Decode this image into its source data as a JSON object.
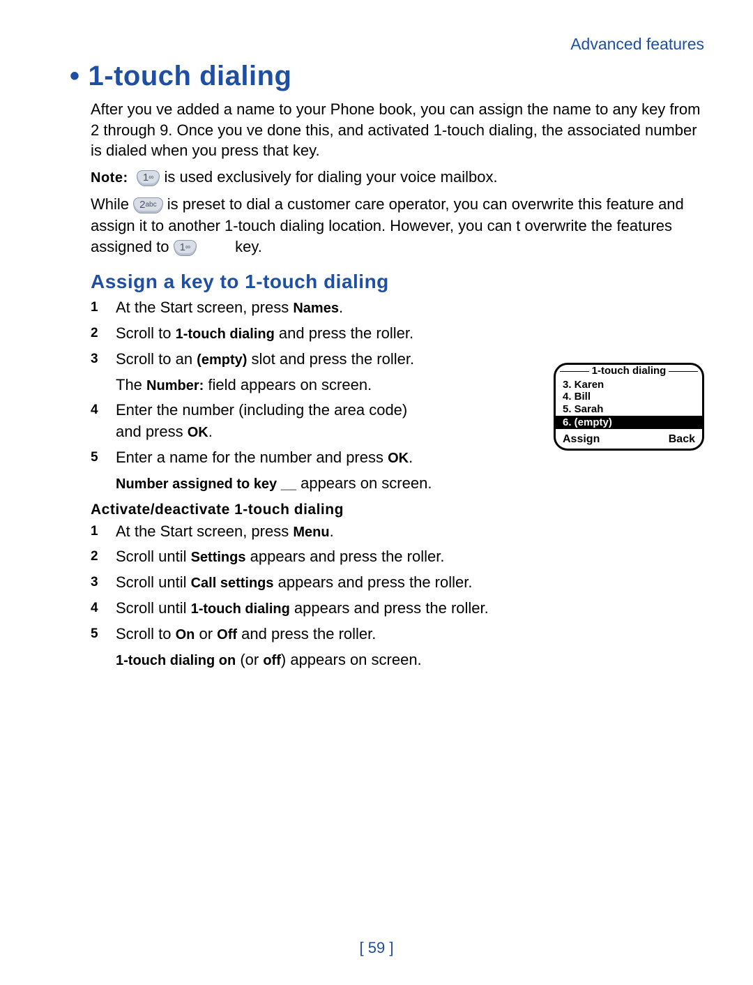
{
  "header": "Advanced features",
  "title": "1-touch dialing",
  "intro": "After you ve added a name to your Phone book, you can assign the name to any key from 2 through 9. Once you ve done this, and activated 1-touch dialing, the associated number is dialed when you press that key.",
  "note": {
    "label": "Note:",
    "key1": "1",
    "key1sym": "∞",
    "after": " is used exclusively for dialing your voice mailbox."
  },
  "while": {
    "pre": "While ",
    "key2": "2",
    "key2abc": "abc",
    "mid": " is preset to dial a customer care operator, you can overwrite this feature and assign it to another 1-touch dialing location. However, you can t overwrite the features assigned to ",
    "key1b": "1",
    "key1bsym": "∞",
    "end": " key."
  },
  "assign_heading": "Assign a key to 1-touch dialing",
  "assign_steps": {
    "s1a": "At the Start screen, press ",
    "s1b": "Names",
    "s1c": ".",
    "s2a": "Scroll to ",
    "s2b": "1-touch dialing",
    "s2c": " and press the roller.",
    "s3a": "Scroll to an ",
    "s3b": "(empty)",
    "s3c": " slot and press the roller.",
    "s3d": "The ",
    "s3e": "Number:",
    "s3f": " field appears on screen.",
    "s4a": "Enter the number (including the area code) and press ",
    "s4b": "OK",
    "s4c": ".",
    "s5a": "Enter a name for the number and press ",
    "s5b": "OK",
    "s5c": ".",
    "s5d": "Number assigned to key __",
    "s5e": " appears on screen."
  },
  "activate_heading": "Activate/deactivate 1-touch dialing",
  "activate_steps": {
    "a1a": "At the Start screen, press ",
    "a1b": "Menu",
    "a1c": ".",
    "a2a": "Scroll until ",
    "a2b": "Settings",
    "a2c": " appears and press the roller.",
    "a3a": "Scroll until ",
    "a3b": "Call settings",
    "a3c": " appears and press the roller.",
    "a4a": "Scroll until ",
    "a4b": "1-touch dialing",
    "a4c": " appears and press the roller.",
    "a5a": "Scroll to ",
    "a5b": "On",
    "a5c": " or ",
    "a5d": "Off",
    "a5e": " and press the roller.",
    "a5f": "1-touch dialing on",
    "a5g": " (or ",
    "a5h": "off",
    "a5i": ") appears on screen."
  },
  "phone": {
    "title": "1-touch dialing",
    "r1": "3. Karen",
    "r2": "4. Bill",
    "r3": "5. Sarah",
    "r4": "6. (empty)",
    "sk_left": "Assign",
    "sk_right": "Back"
  },
  "page_number": "[ 59 ]"
}
